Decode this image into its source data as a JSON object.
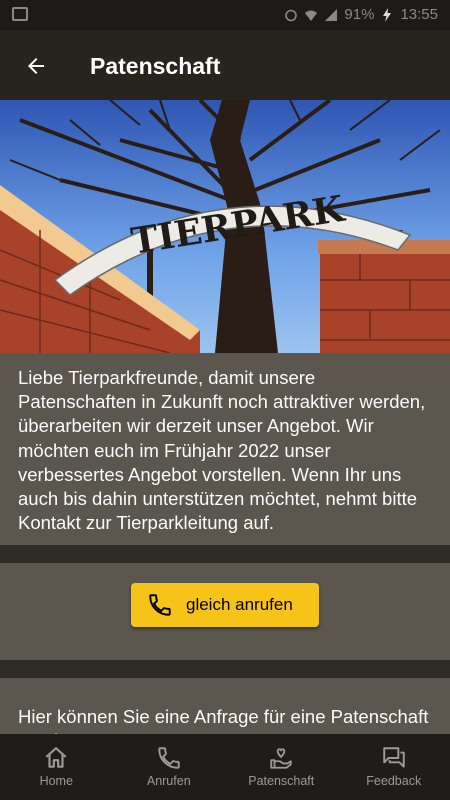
{
  "status_bar": {
    "battery": "91%",
    "time": "13:55"
  },
  "app_bar": {
    "title": "Patenschaft"
  },
  "hero": {
    "sign_text": "TIERPARK"
  },
  "intro_text": "Liebe Tierparkfreunde, damit unsere Patenschaften in Zukunft noch attraktiver werden, überarbeiten wir derzeit unser Angebot. Wir möchten euch im Frühjahr 2022 unser verbessertes Angebot vorstellen. Wenn Ihr uns auch bis dahin unterstützen möchtet, nehmt bitte Kontakt zur Tierparkleitung auf.",
  "call_button": {
    "label": "gleich anrufen",
    "icon": "phone-icon"
  },
  "request_text": "Hier können Sie eine Anfrage für eine Patenschaft senden.",
  "bottom_nav": [
    {
      "label": "Home",
      "icon": "home-icon"
    },
    {
      "label": "Anrufen",
      "icon": "phone-icon"
    },
    {
      "label": "Patenschaft",
      "icon": "heart-hand-icon"
    },
    {
      "label": "Feedback",
      "icon": "chat-icon"
    }
  ],
  "colors": {
    "accent": "#f6c318",
    "app_bar": "#27231d",
    "card": "#5b574f",
    "nav_bg": "#1f1d1a"
  }
}
